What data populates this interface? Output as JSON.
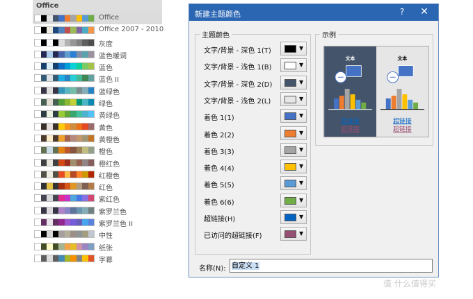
{
  "theme_panel": {
    "header": "Office",
    "themes": [
      {
        "name": "Office",
        "colors": [
          "#ffffff",
          "#000000",
          "#e7e6e6",
          "#44546a",
          "#4472c4",
          "#ed7d31",
          "#a5a5a5",
          "#ffc000",
          "#5b9bd5",
          "#70ad47"
        ]
      },
      {
        "name": "Office 2007 - 2010",
        "colors": [
          "#ffffff",
          "#000000",
          "#eeece1",
          "#1f497d",
          "#4f81bd",
          "#c0504d",
          "#9bbb59",
          "#8064a2",
          "#4bacc6",
          "#f79646"
        ]
      },
      {
        "name": "灰度",
        "colors": [
          "#ffffff",
          "#000000",
          "#f8f8f8",
          "#000000",
          "#dddddd",
          "#b2b2b2",
          "#969696",
          "#808080",
          "#5f5f5f",
          "#4d4d4d"
        ]
      },
      {
        "name": "蓝色暖调",
        "colors": [
          "#ffffff",
          "#242852",
          "#acccea",
          "#242852",
          "#4a66ac",
          "#629dd1",
          "#297fd5",
          "#7f8fa9",
          "#5aa2ae",
          "#9d90a0"
        ]
      },
      {
        "name": "蓝色",
        "colors": [
          "#ffffff",
          "#17406d",
          "#dbeff9",
          "#17406d",
          "#0f6fc6",
          "#009dd9",
          "#0bd0d9",
          "#10cf9b",
          "#7cca62",
          "#a5c249"
        ]
      },
      {
        "name": "蓝色 II",
        "colors": [
          "#ffffff",
          "#335b74",
          "#dfe3e5",
          "#335b74",
          "#1cade4",
          "#2683c6",
          "#27ced7",
          "#42ba97",
          "#3e8853",
          "#62a39f"
        ]
      },
      {
        "name": "蓝绿色",
        "colors": [
          "#ffffff",
          "#373545",
          "#dedfdd",
          "#373545",
          "#3494ba",
          "#58b6c0",
          "#75bda7",
          "#7a8c8e",
          "#84acb6",
          "#2683c6"
        ]
      },
      {
        "name": "绿色",
        "colors": [
          "#ffffff",
          "#455f51",
          "#e3ded1",
          "#455f51",
          "#549e39",
          "#8ab833",
          "#c0cf3a",
          "#029676",
          "#4ab5c4",
          "#0989b1"
        ]
      },
      {
        "name": "黄绿色",
        "colors": [
          "#ffffff",
          "#2c3c43",
          "#eaf1e1",
          "#2c3c43",
          "#99cb38",
          "#63a537",
          "#37a76f",
          "#44c1a3",
          "#4eb3cf",
          "#51c3f9"
        ]
      },
      {
        "name": "黄色",
        "colors": [
          "#ffffff",
          "#39302a",
          "#e5dedb",
          "#39302a",
          "#ffca08",
          "#f8931d",
          "#ce8d3e",
          "#ec7016",
          "#e64823",
          "#9c6a6a"
        ]
      },
      {
        "name": "黄橙色",
        "colors": [
          "#ffffff",
          "#4e3b30",
          "#fbeec9",
          "#4e3b30",
          "#f0a22e",
          "#a5644e",
          "#b58b80",
          "#c3986d",
          "#a19574",
          "#c17529"
        ]
      },
      {
        "name": "橙色",
        "colors": [
          "#ffffff",
          "#637052",
          "#ccddea",
          "#637052",
          "#e48312",
          "#bd582c",
          "#865640",
          "#9b8357",
          "#c2bc80",
          "#94a088"
        ]
      },
      {
        "name": "橙红色",
        "colors": [
          "#ffffff",
          "#3f3f3f",
          "#e9e5dc",
          "#3f3f3f",
          "#d34817",
          "#9b2d1f",
          "#a28e6a",
          "#956251",
          "#918485",
          "#855d5d"
        ]
      },
      {
        "name": "红橙色",
        "colors": [
          "#ffffff",
          "#505046",
          "#eeece1",
          "#505046",
          "#e84c22",
          "#ffbd47",
          "#b64926",
          "#ff8427",
          "#cc9900",
          "#b22600"
        ]
      },
      {
        "name": "红色",
        "colors": [
          "#ffffff",
          "#323232",
          "#e5c243",
          "#323232",
          "#a5300f",
          "#d55816",
          "#e19825",
          "#b19c7d",
          "#7f5f52",
          "#b27d49"
        ]
      },
      {
        "name": "紫红色",
        "colors": [
          "#ffffff",
          "#454551",
          "#d8d9dc",
          "#454551",
          "#e32d91",
          "#c830cc",
          "#4ea6dc",
          "#4775e7",
          "#8971e1",
          "#d54773"
        ]
      },
      {
        "name": "紫罗兰色",
        "colors": [
          "#ffffff",
          "#373545",
          "#dcd8dc",
          "#373545",
          "#ad84c6",
          "#8784c7",
          "#5d739a",
          "#6997af",
          "#84acb6",
          "#6f8183"
        ]
      },
      {
        "name": "紫罗兰色 II",
        "colors": [
          "#ffffff",
          "#632e62",
          "#eae5eb",
          "#632e62",
          "#92278f",
          "#9b57d3",
          "#755dd9",
          "#665eb8",
          "#45a5ed",
          "#5982db"
        ]
      },
      {
        "name": "中性",
        "colors": [
          "#ffffff",
          "#000000",
          "#d6d6d6",
          "#000000",
          "#a69f9d",
          "#b5b09c",
          "#9c8f88",
          "#8f9596",
          "#a39e80",
          "#c1c7d1"
        ]
      },
      {
        "name": "纸张",
        "colors": [
          "#ffffff",
          "#444d26",
          "#fefac9",
          "#444d26",
          "#a5b592",
          "#f3a447",
          "#e7bc29",
          "#d092a7",
          "#9c85c0",
          "#809ec2"
        ]
      },
      {
        "name": "字幕",
        "colors": [
          "#ffffff",
          "#5e5e5e",
          "#ddddde",
          "#5e5e5e",
          "#418ab3",
          "#a6b727",
          "#f69200",
          "#838383",
          "#fec306",
          "#df5327"
        ]
      }
    ]
  },
  "dialog": {
    "title": "新建主题颜色",
    "help_label": "?",
    "close_label": "✕",
    "colors_group_label": "主题颜色",
    "preview_group_label": "示例",
    "color_rows": [
      {
        "label": "文字/背景 - 深色 1(T)",
        "color": "#000000"
      },
      {
        "label": "文字/背景 - 浅色 1(B)",
        "color": "#ffffff"
      },
      {
        "label": "文字/背景 - 深色 2(D)",
        "color": "#44546a"
      },
      {
        "label": "文字/背景 - 浅色 2(L)",
        "color": "#e7e6e6"
      },
      {
        "label": "着色 1(1)",
        "color": "#4472c4"
      },
      {
        "label": "着色 2(2)",
        "color": "#ed7d31"
      },
      {
        "label": "着色 3(3)",
        "color": "#a5a5a5"
      },
      {
        "label": "着色 4(4)",
        "color": "#ffc000"
      },
      {
        "label": "着色 5(5)",
        "color": "#5b9bd5"
      },
      {
        "label": "着色 6(6)",
        "color": "#70ad47"
      },
      {
        "label": "超链接(H)",
        "color": "#0563c1"
      },
      {
        "label": "已访问的超链接(F)",
        "color": "#954f72"
      }
    ],
    "dropdown_arrow": "▼",
    "preview": {
      "text_label": "文本",
      "hyperlink_label": "超链接",
      "dark_bg": "#44546a",
      "light_bg": "#e7e6e6",
      "bar_colors": [
        "#4472c4",
        "#ed7d31",
        "#a5a5a5",
        "#ffc000",
        "#5b9bd5",
        "#70ad47"
      ],
      "link_color": "#0563c1",
      "visited_color": "#954f72"
    },
    "name_label": "名称(N):",
    "name_value": "自定义 1"
  },
  "watermark": "值 什么值得买"
}
